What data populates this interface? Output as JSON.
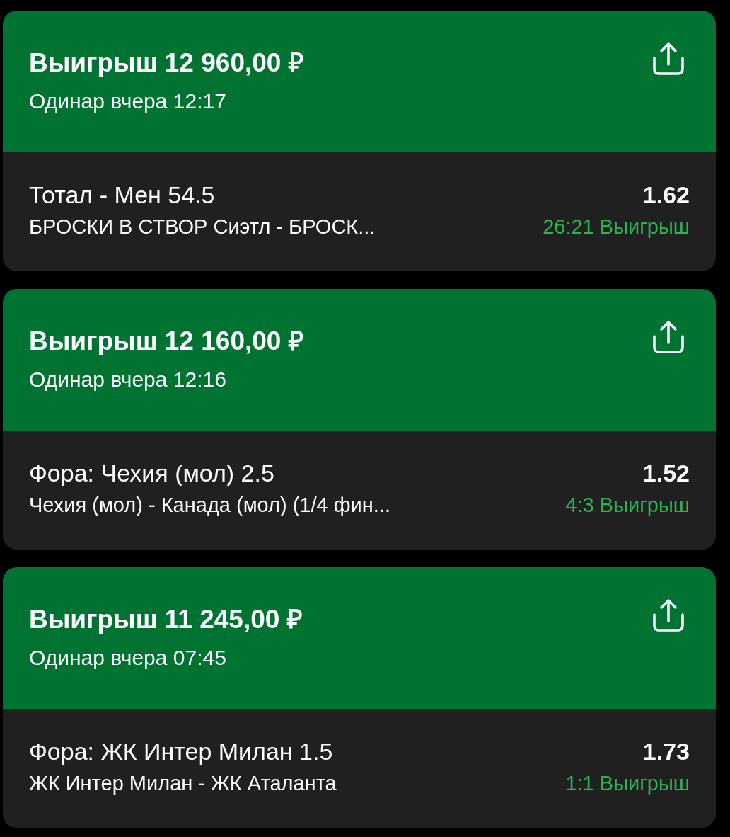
{
  "bets": [
    {
      "title": "Выигрыш 12 960,00 ₽",
      "subtitle": "Одинар вчера 12:17",
      "selection": "Тотал - Мен 54.5",
      "event": "БРОСКИ В СТВОР Сиэтл - БРОСК...",
      "odds": "1.62",
      "result": "26:21 Выигрыш"
    },
    {
      "title": "Выигрыш 12 160,00 ₽",
      "subtitle": "Одинар вчера 12:16",
      "selection": "Фора: Чехия (мол) 2.5",
      "event": "Чехия (мол) - Канада (мол) (1/4 фин...",
      "odds": "1.52",
      "result": "4:3 Выигрыш"
    },
    {
      "title": "Выигрыш 11 245,00 ₽",
      "subtitle": "Одинар вчера 07:45",
      "selection": "Фора: ЖК Интер Милан 1.5",
      "event": "ЖК Интер Милан - ЖК Аталанта",
      "odds": "1.73",
      "result": "1:1 Выигрыш"
    }
  ]
}
